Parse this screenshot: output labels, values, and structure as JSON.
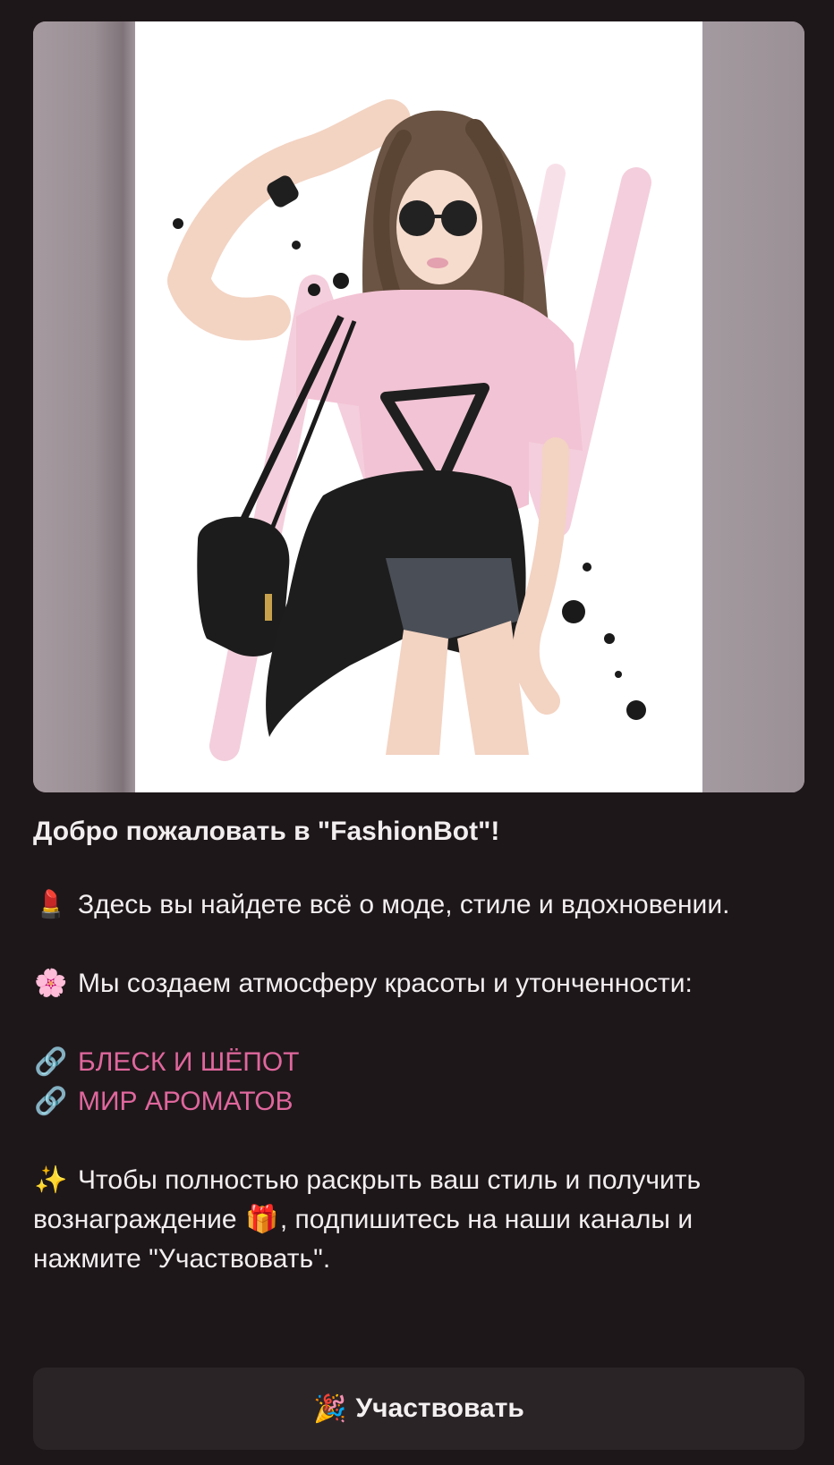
{
  "message": {
    "title": "Добро пожаловать в \"FashionBot\"!",
    "line1_icon": "lipstick-icon",
    "line1_emoji": "💄",
    "line1_text": "Здесь вы найдете всё о моде, стиле и вдохновении.",
    "line2_icon": "cherry-blossom-icon",
    "line2_emoji": "🌸",
    "line2_text": "Мы создаем атмосферу красоты и утонченности:",
    "links": [
      {
        "icon": "link-icon",
        "emoji": "🔗",
        "label": "БЛЕСК И ШЁПОТ"
      },
      {
        "icon": "link-icon",
        "emoji": "🔗",
        "label": "МИР АРОМАТОВ"
      }
    ],
    "line3_icon": "sparkles-icon",
    "line3_emoji": "✨",
    "line3_text_a": "Чтобы полностью раскрыть ваш стиль и получить вознаграждение ",
    "gift_icon": "gift-icon",
    "gift_emoji": "🎁",
    "line3_text_b": ", подпишитесь на наши каналы и нажмите \"Участвовать\"."
  },
  "button": {
    "icon": "party-popper-icon",
    "emoji": "🎉",
    "label": "Участвовать"
  },
  "colors": {
    "background": "#1e171a",
    "link": "#e0679d",
    "text": "#f2eef0",
    "button_bg": "#2b2427"
  }
}
